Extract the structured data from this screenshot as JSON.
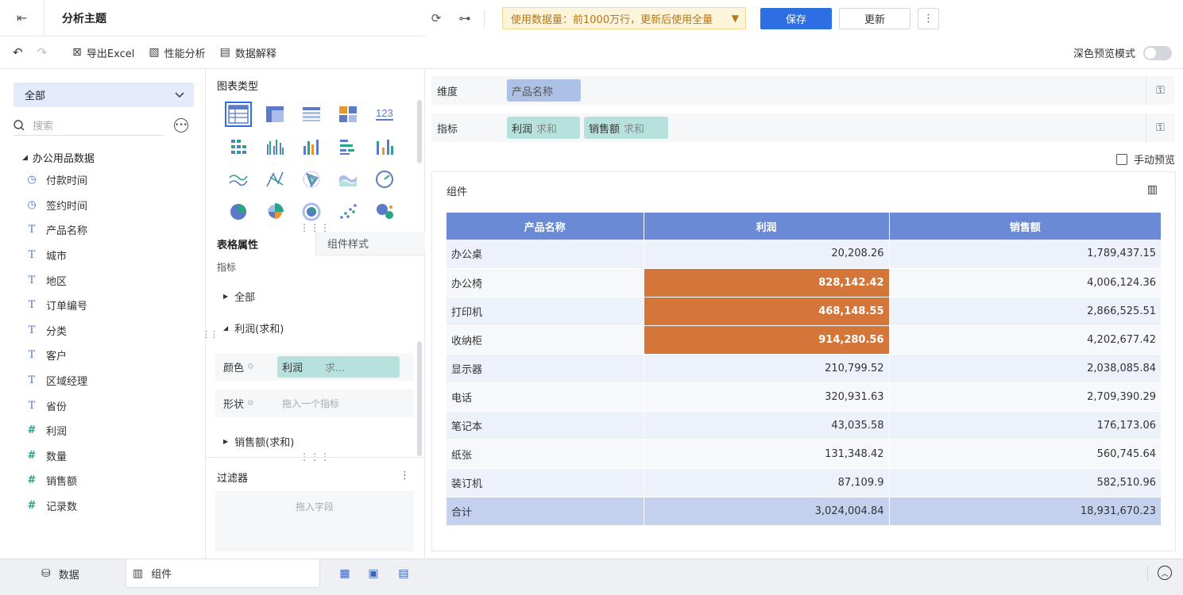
{
  "header": {
    "title": "分析主题",
    "notice": "使用数据量：前1000万行，更新后使用全量",
    "save_label": "保存",
    "update_label": "更新",
    "more_label": "⋮"
  },
  "toolbar": {
    "export_label": "导出Excel",
    "perf_label": "性能分析",
    "explain_label": "数据解释",
    "dark_mode_label": "深色预览模式"
  },
  "left": {
    "select_value": "全部",
    "search_placeholder": "搜索",
    "dataset": "办公用品数据",
    "fields": [
      {
        "name": "付款时间",
        "type": "time"
      },
      {
        "name": "签约时间",
        "type": "time"
      },
      {
        "name": "产品名称",
        "type": "text"
      },
      {
        "name": "城市",
        "type": "text"
      },
      {
        "name": "地区",
        "type": "text"
      },
      {
        "name": "订单编号",
        "type": "text"
      },
      {
        "name": "分类",
        "type": "text"
      },
      {
        "name": "客户",
        "type": "text"
      },
      {
        "name": "区域经理",
        "type": "text"
      },
      {
        "name": "省份",
        "type": "text"
      },
      {
        "name": "利润",
        "type": "num"
      },
      {
        "name": "数量",
        "type": "num"
      },
      {
        "name": "销售额",
        "type": "num"
      },
      {
        "name": "记录数",
        "type": "num"
      }
    ]
  },
  "middle": {
    "chart_types_title": "图表类型",
    "tab_table_props": "表格属性",
    "tab_widget_style": "组件样式",
    "section_label": "指标",
    "all_label": "全部",
    "profit_label": "利润(求和)",
    "color_label": "颜色",
    "color_chip": "利润",
    "color_chip_suffix": "求...",
    "shape_label": "形状",
    "shape_placeholder": "拖入一个指标",
    "sales_label": "销售额(求和)",
    "filter_title": "过滤器",
    "filter_placeholder": "拖入字段"
  },
  "right": {
    "dimension_label": "维度",
    "dimension_pill": "产品名称",
    "measure_label": "指标",
    "measures": [
      {
        "name": "利润",
        "agg": "求和"
      },
      {
        "name": "销售额",
        "agg": "求和"
      }
    ],
    "manual_preview_label": "手动预览",
    "widget_title": "组件",
    "table": {
      "headers": [
        "产品名称",
        "利润",
        "销售额"
      ],
      "rows": [
        {
          "name": "办公桌",
          "profit": "20,208.26",
          "sales": "1,789,437.15",
          "highlight": false
        },
        {
          "name": "办公椅",
          "profit": "828,142.42",
          "sales": "4,006,124.36",
          "highlight": true
        },
        {
          "name": "打印机",
          "profit": "468,148.55",
          "sales": "2,866,525.51",
          "highlight": true
        },
        {
          "name": "收纳柜",
          "profit": "914,280.56",
          "sales": "4,202,677.42",
          "highlight": true
        },
        {
          "name": "显示器",
          "profit": "210,799.52",
          "sales": "2,038,085.84",
          "highlight": false
        },
        {
          "name": "电话",
          "profit": "320,931.63",
          "sales": "2,709,390.29",
          "highlight": false
        },
        {
          "name": "笔记本",
          "profit": "43,035.58",
          "sales": "176,173.06",
          "highlight": false
        },
        {
          "name": "纸张",
          "profit": "131,348.42",
          "sales": "560,745.64",
          "highlight": false
        },
        {
          "name": "装订机",
          "profit": "87,109.9",
          "sales": "582,510.96",
          "highlight": false
        }
      ],
      "total": {
        "name": "合计",
        "profit": "3,024,004.84",
        "sales": "18,931,670.23"
      }
    }
  },
  "bottom": {
    "tab_data": "数据",
    "tab_widget": "组件"
  },
  "colors": {
    "primary": "#2e6ee3",
    "header_row": "#6a8ad6",
    "highlight": "#d4763a"
  }
}
